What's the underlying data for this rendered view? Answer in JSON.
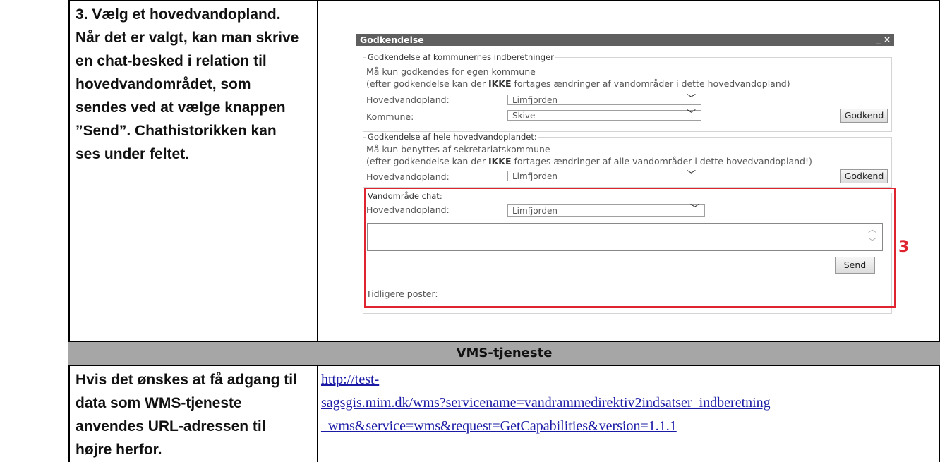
{
  "step": {
    "lines": [
      "3. Vælg et hovedvandopland.",
      "Når det er valgt, kan man skrive",
      "en chat-besked i relation til",
      "hovedvandområdet, som",
      "sendes ved at vælge knappen",
      "”Send”. Chathistorikken kan",
      "ses under feltet."
    ]
  },
  "dialog": {
    "title": "Godkendelse",
    "controls": "_ ×",
    "group1": {
      "legend": "Godkendelse af kommunernes indberetninger",
      "line1": "Må kun godkendes for egen kommune",
      "line2_pre": "(efter godkendelse kan der ",
      "line2_bold": "IKKE",
      "line2_post": " fortages ændringer af vandområder i dette hovedvandopland)",
      "hov_label": "Hovedvandopland:",
      "hov_value": "Limfjorden",
      "kom_label": "Kommune:",
      "kom_value": "Skive",
      "button": "Godkend"
    },
    "group2": {
      "legend": "Godkendelse af hele hovedvandoplandet:",
      "line1": "Må kun benyttes af sekretariatskommune",
      "line2_pre": "(efter godkendelse kan der ",
      "line2_bold": "IKKE",
      "line2_post": " fortages ændringer af alle vandområder i dette hovedvandopland!)",
      "hov_label": "Hovedvandopland:",
      "hov_value": "Limfjorden",
      "button": "Godkend"
    },
    "chat": {
      "legend": "Vandområde chat:",
      "hov_label": "Hovedvandopland:",
      "hov_value": "Limfjorden",
      "message_value": "",
      "send_button": "Send",
      "history_label": "Tidligere poster:"
    },
    "annotation": "3"
  },
  "section": {
    "title": "VMS-tjeneste"
  },
  "wms": {
    "lines": [
      "Hvis det ønskes at få adgang til",
      "data som WMS-tjeneste",
      "anvendes URL-adressen til",
      "højre herfor."
    ],
    "url_lines": [
      "http://test-",
      "sagsgis.mim.dk/wms?servicename=vandrammedirektiv2indsatser_indberetning",
      "_wms&service=wms&request=GetCapabilities&version=1.1.1"
    ]
  },
  "colors": {
    "annotation_red": "#e0242f",
    "section_bar": "#a6a6a6",
    "title_bar": "#5f5f5f",
    "link": "#1a1aa6"
  }
}
